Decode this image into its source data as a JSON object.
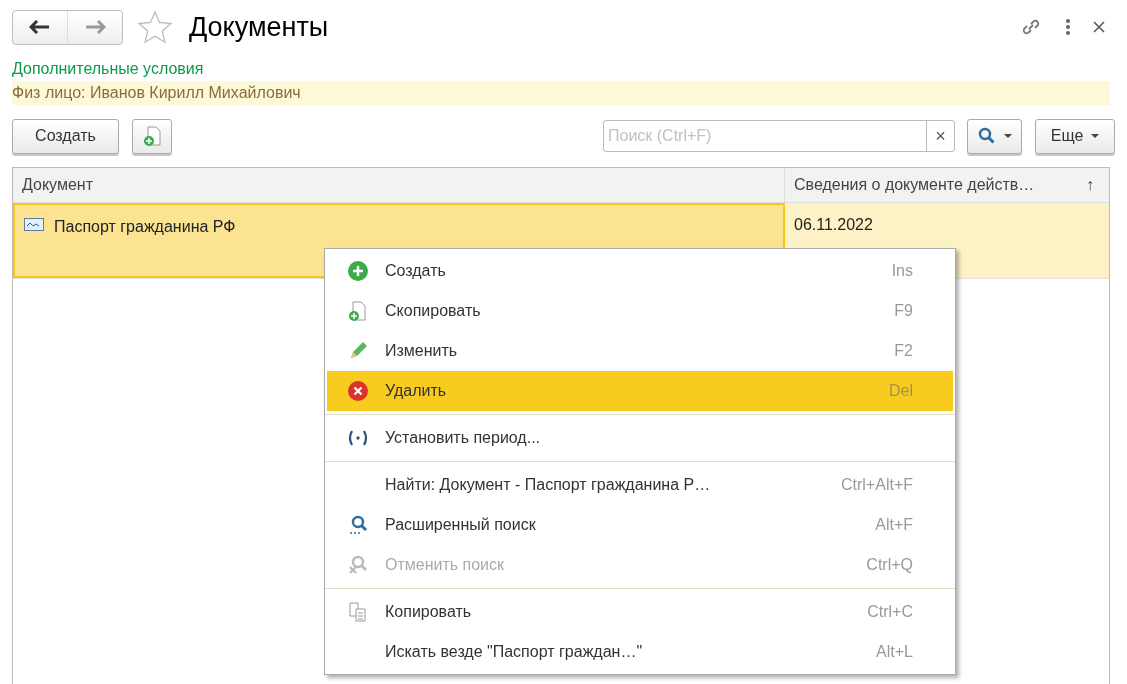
{
  "window": {
    "title": "Документы",
    "favorite": false
  },
  "filter": {
    "link": "Дополнительные условия",
    "condition": "Физ лицо: Иванов Кирилл Михайлович"
  },
  "toolbar": {
    "create_button": "Создать",
    "search": {
      "placeholder": "Поиск (Ctrl+F)",
      "clear": "×"
    },
    "more_button": "Еще"
  },
  "table": {
    "columns": [
      {
        "label": "Документ"
      },
      {
        "label": "Сведения о документе действ…",
        "sort": "↑"
      }
    ],
    "rows": [
      {
        "cells": [
          "Паспорт гражданина РФ",
          "06.11.2022"
        ],
        "selected": true
      }
    ]
  },
  "context_menu": {
    "groups": [
      [
        {
          "label": "Создать",
          "shortcut": "Ins",
          "kind": "add",
          "selected": false,
          "disabled": false
        },
        {
          "label": "Скопировать",
          "shortcut": "F9",
          "kind": "copy",
          "selected": false,
          "disabled": false
        },
        {
          "label": "Изменить",
          "shortcut": "F2",
          "kind": "edit",
          "selected": false,
          "disabled": false
        },
        {
          "label": "Удалить",
          "shortcut": "Del",
          "kind": "delete",
          "selected": true,
          "disabled": false
        }
      ],
      [
        {
          "label": "Установить период...",
          "kind": "period",
          "selected": false,
          "disabled": false
        }
      ],
      [
        {
          "label": "Найти: Документ - Паспорт гражданина Р…",
          "shortcut": "Ctrl+Alt+F",
          "kind": "plain",
          "selected": false,
          "disabled": false
        },
        {
          "label": "Расширенный поиск",
          "shortcut": "Alt+F",
          "kind": "search",
          "selected": false,
          "disabled": false
        },
        {
          "label": "Отменить поиск",
          "shortcut": "Ctrl+Q",
          "kind": "unsearch",
          "selected": false,
          "disabled": true
        }
      ],
      [
        {
          "label": "Копировать",
          "shortcut": "Ctrl+C",
          "kind": "clipboard",
          "selected": false,
          "disabled": false
        },
        {
          "label": "Искать везде \"Паспорт граждан…\"",
          "shortcut": "Alt+L",
          "kind": "plain",
          "selected": false,
          "disabled": false
        }
      ]
    ]
  }
}
